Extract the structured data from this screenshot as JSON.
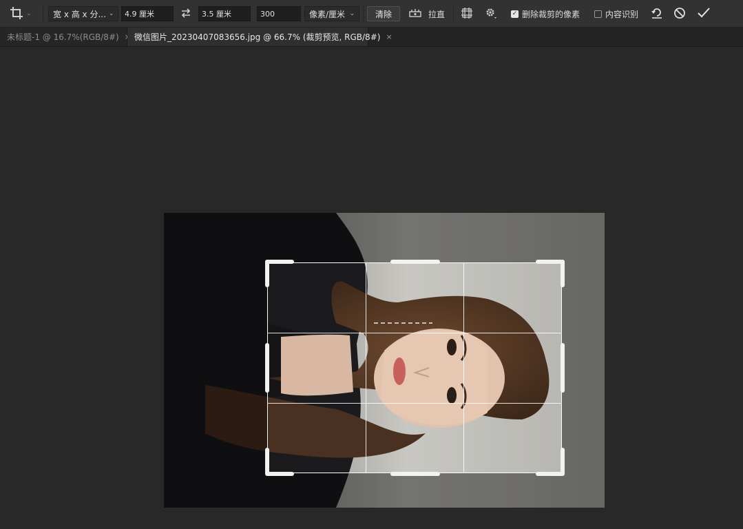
{
  "options_bar": {
    "tool_icon": "crop-tool-icon",
    "ratio_preset": "宽 x 高 x 分...",
    "width_value": "4.9 厘米",
    "swap_icon": "swap-arrows-icon",
    "height_value": "3.5 厘米",
    "resolution_value": "300",
    "resolution_unit": "像素/厘米",
    "clear_label": "清除",
    "straighten_icon": "straighten-level-icon",
    "straighten_label": "拉直",
    "overlay_icon": "grid-overlay-icon",
    "settings_icon": "gear-icon",
    "delete_cropped_label": "删除裁剪的像素",
    "delete_cropped_checked": true,
    "content_aware_label": "内容识别",
    "content_aware_checked": false,
    "reset_icon": "reset-icon",
    "cancel_icon": "cancel-icon",
    "commit_icon": "checkmark-icon"
  },
  "tabs": [
    {
      "label": "未标题-1 @ 16.7%(RGB/8#)",
      "active": false
    },
    {
      "label": "微信图片_20230407083656.jpg @ 66.7% (裁剪预览, RGB/8#)",
      "active": true
    }
  ],
  "colors": {
    "workspace": "#282828",
    "options_bar": "#323232",
    "photo_background": "#9c9b97",
    "clothing": "#1b1b1e",
    "hair": "#5a3a25",
    "skin": "#e2c2ad",
    "crop_border": "#ffffff"
  }
}
